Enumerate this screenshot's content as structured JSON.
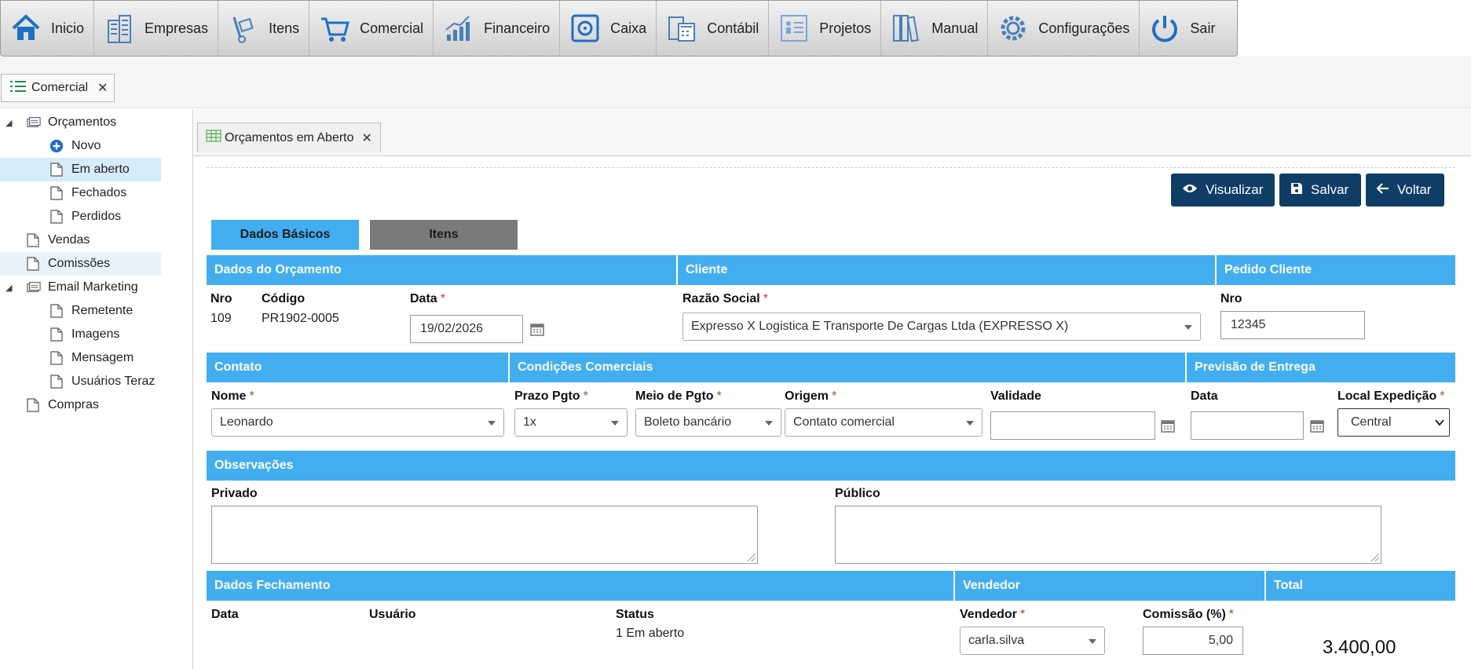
{
  "menu": {
    "items": [
      {
        "label": "Inicio"
      },
      {
        "label": "Empresas"
      },
      {
        "label": "Itens"
      },
      {
        "label": "Comercial"
      },
      {
        "label": "Financeiro"
      },
      {
        "label": "Caixa"
      },
      {
        "label": "Contábil"
      },
      {
        "label": "Projetos"
      },
      {
        "label": "Manual"
      },
      {
        "label": "Configurações"
      },
      {
        "label": "Sair"
      }
    ]
  },
  "module_tab": {
    "label": "Comercial",
    "close": "✕"
  },
  "sidebar": {
    "orcamentos": "Orçamentos",
    "novo": "Novo",
    "em_aberto": "Em aberto",
    "fechados": "Fechados",
    "perdidos": "Perdidos",
    "vendas": "Vendas",
    "comissoes": "Comissões",
    "email_marketing": "Email Marketing",
    "remetente": "Remetente",
    "imagens": "Imagens",
    "mensagem": "Mensagem",
    "usuarios_teraz": "Usuários Teraz",
    "compras": "Compras"
  },
  "inner_tab": {
    "label": "Orçamentos em Aberto",
    "close": "✕"
  },
  "actions": {
    "visualizar": "Visualizar",
    "salvar": "Salvar",
    "voltar": "Voltar"
  },
  "subtabs": {
    "dados_basicos": "Dados Básicos",
    "itens": "Itens"
  },
  "sections": {
    "dados_orcamento": "Dados do Orçamento",
    "cliente": "Cliente",
    "pedido_cliente": "Pedido Cliente",
    "contato": "Contato",
    "condicoes_comerciais": "Condições Comerciais",
    "previsao_entrega": "Previsão de Entrega",
    "observacoes": "Observações",
    "dados_fechamento": "Dados Fechamento",
    "vendedor": "Vendedor",
    "total": "Total"
  },
  "orcamento": {
    "nro_label": "Nro",
    "nro_value": "109",
    "codigo_label": "Código",
    "codigo_value": "PR1902-0005",
    "data_label": "Data",
    "data_value": "19/02/2026"
  },
  "cliente": {
    "razao_label": "Razão Social",
    "razao_value": "Expresso X Logistica E Transporte De Cargas Ltda (EXPRESSO X)"
  },
  "pedido": {
    "nro_label": "Nro",
    "nro_value": "12345"
  },
  "contato": {
    "nome_label": "Nome",
    "nome_value": "Leonardo"
  },
  "condicoes": {
    "prazo_label": "Prazo Pgto",
    "prazo_value": "1x",
    "meio_label": "Meio de Pgto",
    "meio_value": "Boleto bancário",
    "origem_label": "Origem",
    "origem_value": "Contato comercial",
    "validade_label": "Validade",
    "validade_value": ""
  },
  "entrega": {
    "data_label": "Data",
    "data_value": "",
    "local_label": "Local Expedição",
    "local_value": "Central"
  },
  "observacoes": {
    "privado_label": "Privado",
    "publico_label": "Público"
  },
  "fechamento": {
    "data_label": "Data",
    "usuario_label": "Usuário",
    "status_label": "Status",
    "status_value": "1 Em aberto"
  },
  "vendedor": {
    "vendedor_label": "Vendedor",
    "vendedor_value": "carla.silva",
    "comissao_label": "Comissão (%)",
    "comissao_value": "5,00"
  },
  "total": {
    "value": "3.400,00"
  },
  "required_mark": "*",
  "colors": {
    "section_blue": "#42aef0",
    "button_navy": "#0f3d66",
    "selected_row": "#d6ecfa"
  }
}
